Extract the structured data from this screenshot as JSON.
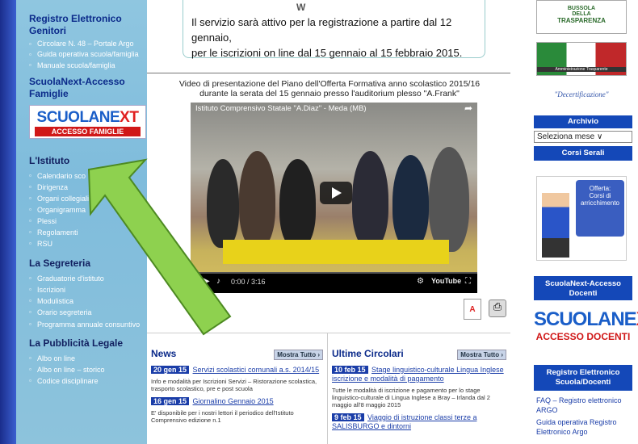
{
  "sidebar": {
    "sec_registro": "Registro Elettronico Genitori",
    "registro_items": [
      "Circolare N. 48 – Portale Argo",
      "Guida operativa scuola/famiglia",
      "Manuale scuola/famiglia"
    ],
    "sec_scuolanext": "ScuolaNext-Accesso Famiglie",
    "scuolanext_logo_a": "SCUOLANE",
    "scuolanext_logo_b": "XT",
    "scuolanext_sub": "ACCESSO FAMIGLIE",
    "sec_istituto": "L'Istituto",
    "istituto_items": [
      "Calendario sco",
      "Dirigenza",
      "Organi collegiali",
      "Organigramma",
      "Plessi",
      "Regolamenti",
      "RSU"
    ],
    "sec_segreteria": "La Segreteria",
    "segreteria_items": [
      "Graduatorie d'istituto",
      "Iscrizioni",
      "Modulistica",
      "Orario segreteria",
      "Programma annuale consuntivo"
    ],
    "sec_pubblicita": "La Pubblicità Legale",
    "pubblicita_items": [
      "Albo on line",
      "Albo on line – storico",
      "Codice disciplinare"
    ]
  },
  "notice": {
    "top": "W",
    "line1": "Il servizio sarà attivo per la registrazione a partire dal 12 gennaio,",
    "line2": "per le iscrizioni on line dal 15 gennaio al 15 febbraio 2015."
  },
  "video": {
    "caption_l1": "Video di presentazione del Piano dell'Offerta Formativa anno scolastico 2015/16",
    "caption_l2": "durante la serata del 15 gennaio presso l'auditorium plesso \"A.Frank\"",
    "title": "Istituto Comprensivo Statale \"A.Diaz\" - Meda (MB)",
    "time": "0:00 / 3:16",
    "youtube": "YouTube"
  },
  "news": {
    "heading": "News",
    "more": "Mostra Tutto ›",
    "items": [
      {
        "date": "20 gen 15",
        "title": "Servizi scolastici comunali a.s. 2014/15",
        "desc": "Info e modalità per Iscrizioni Servizi – Ristorazione scolastica, trasporto scolastico, pre e post scuola"
      },
      {
        "date": "16 gen 15",
        "title": "Giornalino Gennaio 2015",
        "desc": "E' disponibile per i nostri lettori il periodico dell'Istituto Comprensivo edizione n.1"
      }
    ]
  },
  "circolari": {
    "heading": "Ultime Circolari",
    "more": "Mostra Tutto ›",
    "items": [
      {
        "date": "10 feb 15",
        "title": "Stage linguistico-culturale Lingua Inglese iscrizione e modalità di pagamento",
        "desc": "Tutte le modalità di iscrizione e pagamento per lo stage linguistico-culturale di Lingua Inglese a Bray – Irlanda dal 2 maggio all'8 maggio 2015"
      },
      {
        "date": "9 feb 15",
        "title": "Viaggio di istruzione classi terze a SALISBURGO e dintorni",
        "desc": ""
      }
    ]
  },
  "right": {
    "bussola_a": "BUSSOLA",
    "bussola_b": "DELLA",
    "bussola_c": "TRASPARENZA",
    "amm_trasp": "Amministrazione Trasparente",
    "decert": "\"Decertificazione\"",
    "archivio": "Archivio",
    "select": "Seleziona mese",
    "corsi_serali": "Corsi Serali",
    "offerta_l1": "Offerta:",
    "offerta_l2": "Corsi di arricchimento",
    "sndoc_btn": "ScuolaNext-Accesso Docenti",
    "sndoc_logo_a": "SCUOLANE",
    "sndoc_logo_b": "XT",
    "sndoc_sub": "ACCESSO DOCENTI",
    "reg_doc_btn": "Registro Elettronico Scuola/Docenti",
    "links": [
      "FAQ – Registro elettronico ARGO",
      "Guida operativa Registro Elettronico Argo"
    ]
  },
  "colors": {
    "accent_blue": "#1448b8",
    "sidebar_bg": "#8fc6e0",
    "arrow_green": "#8ed14f"
  }
}
